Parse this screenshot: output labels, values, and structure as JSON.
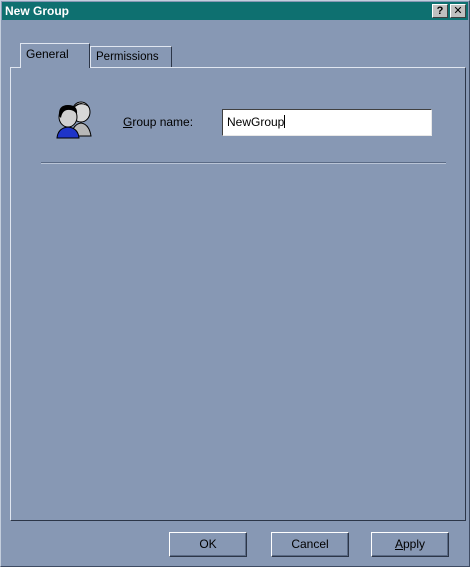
{
  "window": {
    "title": "New Group",
    "help_glyph": "?",
    "close_glyph": "✕"
  },
  "tabs": [
    {
      "label": "General",
      "selected": true
    },
    {
      "label": "Permissions",
      "selected": false
    }
  ],
  "general": {
    "group_icon": "users-group-icon",
    "group_name_label_accel": "G",
    "group_name_label_rest": "roup name:",
    "group_name_value": "NewGroup"
  },
  "buttons": {
    "ok_label": "OK",
    "cancel_label": "Cancel",
    "apply_accel": "A",
    "apply_rest": "pply"
  },
  "colors": {
    "titlebar": "#0e7070",
    "dialog_bg": "#8798b4"
  }
}
